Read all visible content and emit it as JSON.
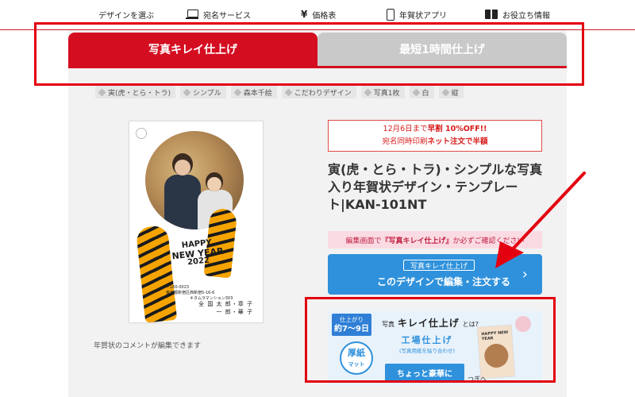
{
  "topnav": {
    "items": [
      {
        "icon": "grid-icon",
        "label": "デザインを選ぶ"
      },
      {
        "icon": "laptop-icon",
        "label": "宛名サービス"
      },
      {
        "icon": "yen-icon",
        "label": "価格表"
      },
      {
        "icon": "smartphone-icon",
        "label": "年賀状アプリ"
      },
      {
        "icon": "book-icon",
        "label": "お役立ち情報"
      }
    ]
  },
  "tabs": [
    {
      "label": "写真キレイ仕上げ",
      "active": true
    },
    {
      "label": "最短1時間仕上げ",
      "active": false
    }
  ],
  "tags": [
    "寅(虎・とら・トラ)",
    "シンプル",
    "森本千絵",
    "こだわりデザイン",
    "写真1枚",
    "白",
    "縦"
  ],
  "card": {
    "greeting_line1": "HAPPY",
    "greeting_line2": "NEW YEAR",
    "greeting_line3": "2022",
    "postal": "〒160-0023",
    "address1": "東京都新宿区西新宿5-16-6",
    "address2": "キタムラマンション303",
    "names1": "全 国 太 郎・章 子",
    "names2": "一 郎・華 子"
  },
  "comment_note": "年賀状のコメントが編集できます",
  "promo": {
    "line1_pre": "12月6日まで",
    "line1_em": "早割 10%OFF!!",
    "line2_pre": "宛名同時印刷",
    "line2_em": "ネット注文で半額"
  },
  "product_title": "寅(虎・とら・トラ)・シンプルな写真入り年賀状デザイン・テンプレート|KAN-101NT",
  "warning": {
    "pre": "編集画面で",
    "em": "『写真キレイ仕上げ』",
    "post": "か必ずご確認ください"
  },
  "cta": {
    "sub_label": "写真キレイ仕上げ",
    "main_label": "このデザインで編集・注文する",
    "chevron": "›"
  },
  "banner": {
    "badge_line1": "仕上がり",
    "badge_line2": "約7〜9日",
    "head_small": "写真",
    "head_big": "キレイ仕上げ",
    "head_tail": "とは?",
    "mat_line1": "厚紙",
    "mat_line2": "マット",
    "factory": "工場仕上げ",
    "factory_sub": "(写真用紙を貼り合わせ)",
    "lux": "ちょっと豪華に",
    "mini_text": "HAPPY NEW YEAR",
    "next_text": "つぎへ"
  },
  "colors": {
    "brand_red": "#d40d21",
    "annotation_red": "#e3000f",
    "cta_blue": "#2f91db",
    "tab_inactive": "#c9c9c9"
  }
}
